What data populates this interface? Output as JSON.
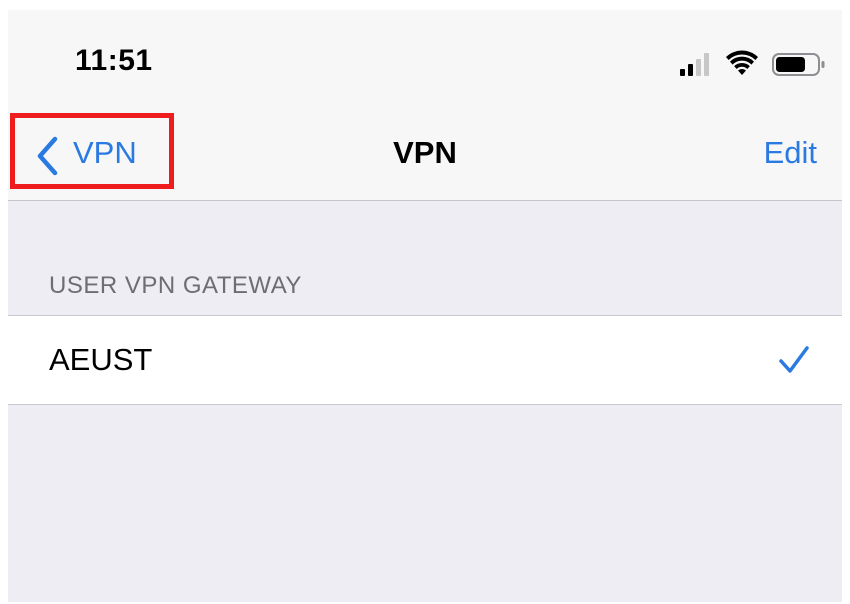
{
  "status_bar": {
    "time": "11:51",
    "icons": [
      "signal-icon",
      "wifi-icon",
      "battery-icon"
    ]
  },
  "nav": {
    "back_label": "VPN",
    "back_icon": "chevron-left-icon",
    "title": "VPN",
    "edit_label": "Edit"
  },
  "section": {
    "header": "USER VPN GATEWAY",
    "items": [
      {
        "label": "AEUST",
        "selected": true,
        "icon": "checkmark-icon"
      }
    ]
  },
  "colors": {
    "accent": "#2a7ae2",
    "highlight_box": "#ee1c1c",
    "grouped_background": "#efedf4"
  }
}
